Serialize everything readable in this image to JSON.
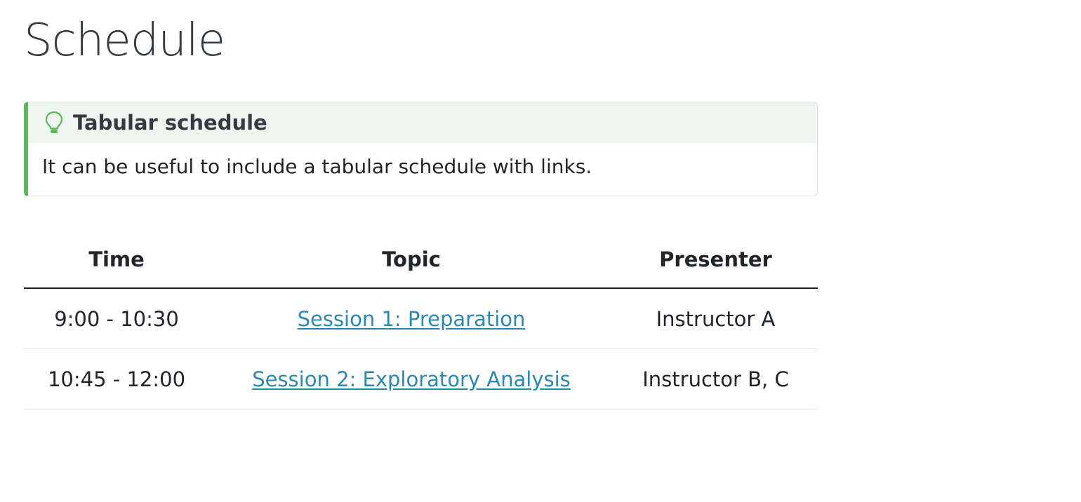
{
  "page": {
    "title": "Schedule"
  },
  "callout": {
    "icon": "lightbulb-icon",
    "title": "Tabular schedule",
    "body": "It can be useful to include a tabular schedule with links.",
    "accent_color": "#5cb85c",
    "header_bg": "#eef7ef"
  },
  "table": {
    "headers": [
      "Time",
      "Topic",
      "Presenter"
    ],
    "rows": [
      {
        "time": "9:00 - 10:30",
        "topic": "Session 1: Preparation",
        "presenter": "Instructor A"
      },
      {
        "time": "10:45 - 12:00",
        "topic": "Session 2: Exploratory Analysis",
        "presenter": "Instructor B, C"
      }
    ],
    "link_color": "#2c88b0"
  }
}
